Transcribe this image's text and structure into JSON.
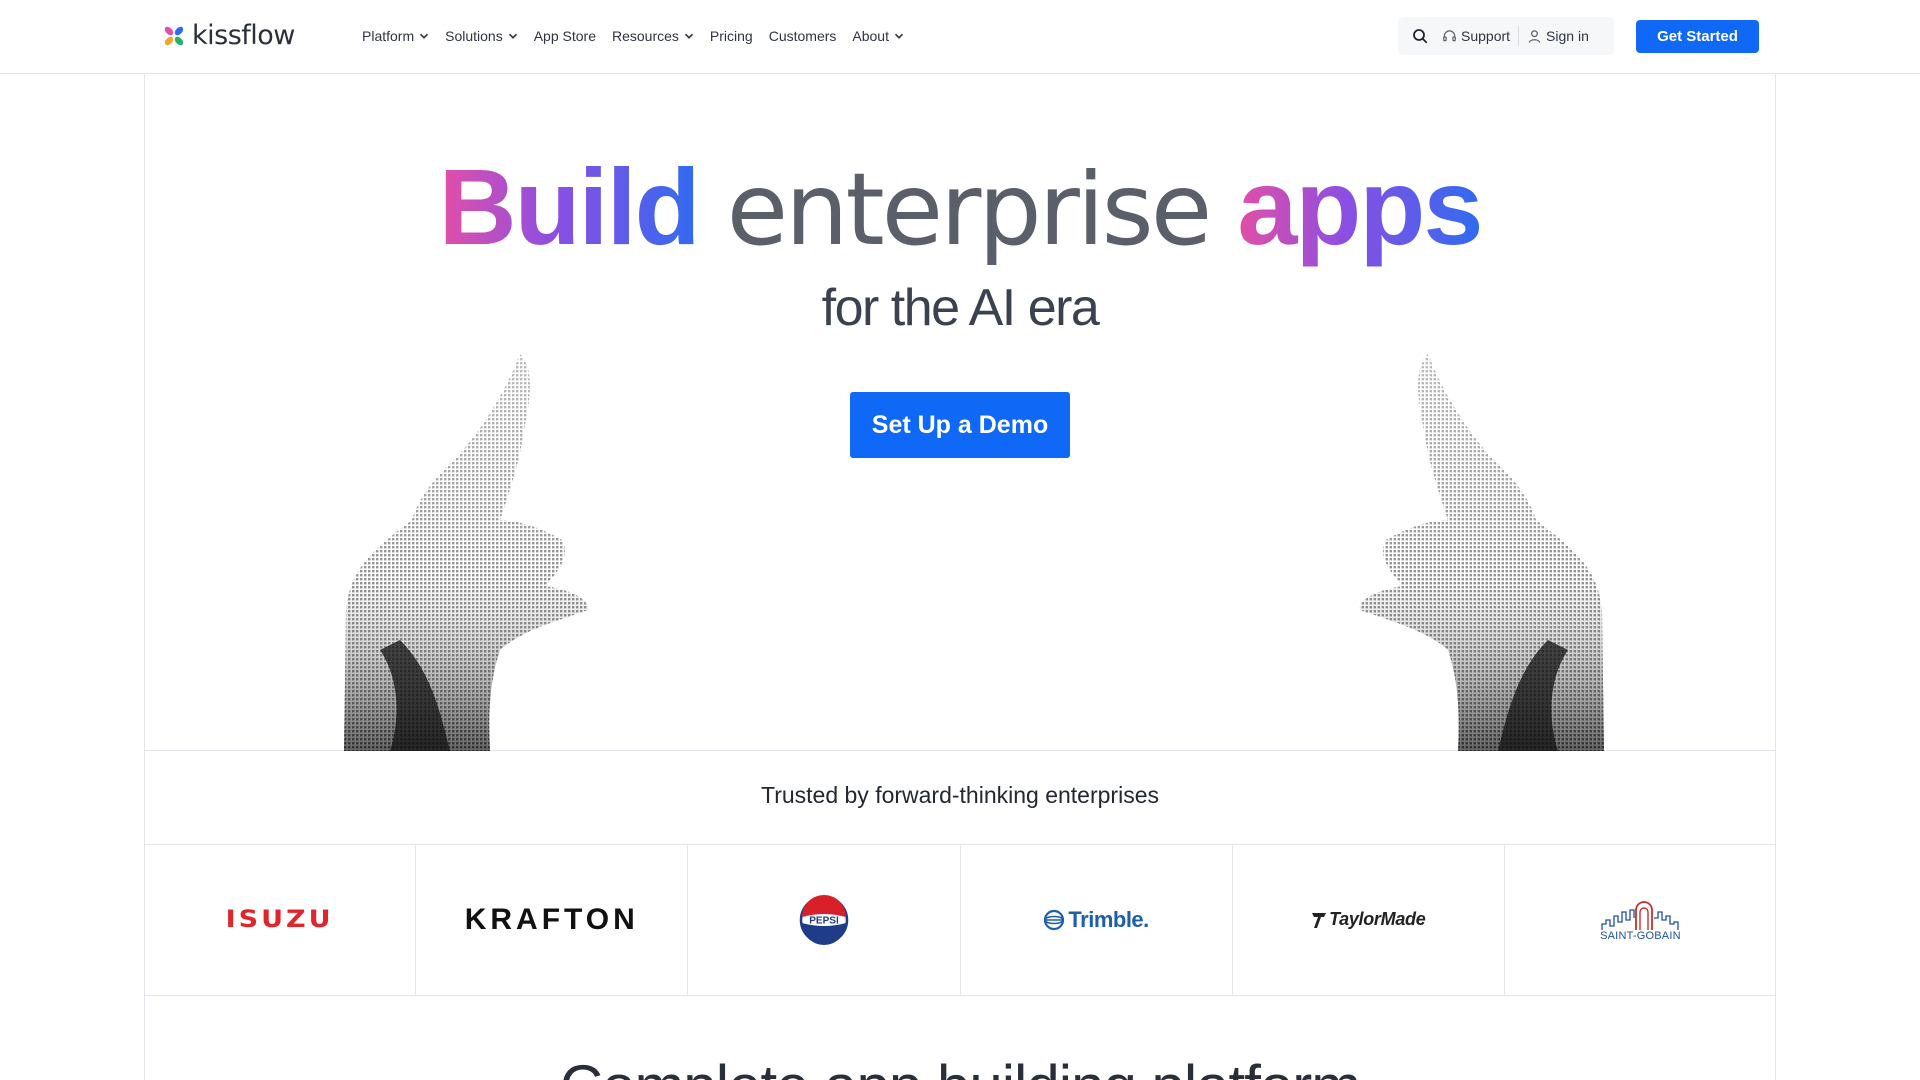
{
  "header": {
    "brand": "kissflow",
    "nav": [
      {
        "label": "Platform",
        "has_dropdown": true
      },
      {
        "label": "Solutions",
        "has_dropdown": true
      },
      {
        "label": "App Store",
        "has_dropdown": false
      },
      {
        "label": "Resources",
        "has_dropdown": true
      },
      {
        "label": "Pricing",
        "has_dropdown": false
      },
      {
        "label": "Customers",
        "has_dropdown": false
      },
      {
        "label": "About",
        "has_dropdown": true
      }
    ],
    "support_label": "Support",
    "signin_label": "Sign in",
    "cta_label": "Get Started"
  },
  "hero": {
    "title_part1": "Build",
    "title_part2": "enterprise",
    "title_part3": "apps",
    "subtitle": "for the AI era",
    "cta_label": "Set Up a Demo"
  },
  "trusted": {
    "heading": "Trusted by forward-thinking enterprises",
    "logos": [
      {
        "name": "ISUZU",
        "icon": "isuzu-logo"
      },
      {
        "name": "KRAFTON",
        "icon": "krafton-logo"
      },
      {
        "name": "PEPSI",
        "icon": "pepsi-logo"
      },
      {
        "name": "Trimble.",
        "icon": "trimble-logo"
      },
      {
        "name": "TaylorMade",
        "icon": "taylormade-logo"
      },
      {
        "name": "SAINT-GOBAIN",
        "icon": "saint-gobain-logo"
      }
    ]
  },
  "next_section": {
    "heading": "Complete app building platform"
  },
  "colors": {
    "primary": "#1068f7",
    "gradient_start": "#e34fa7",
    "gradient_mid": "#8a4fe3",
    "gradient_end": "#2f6bf0",
    "isuzu_red": "#e0252c",
    "pepsi_blue": "#1f3c88",
    "trimble_blue": "#1f5fa8"
  }
}
